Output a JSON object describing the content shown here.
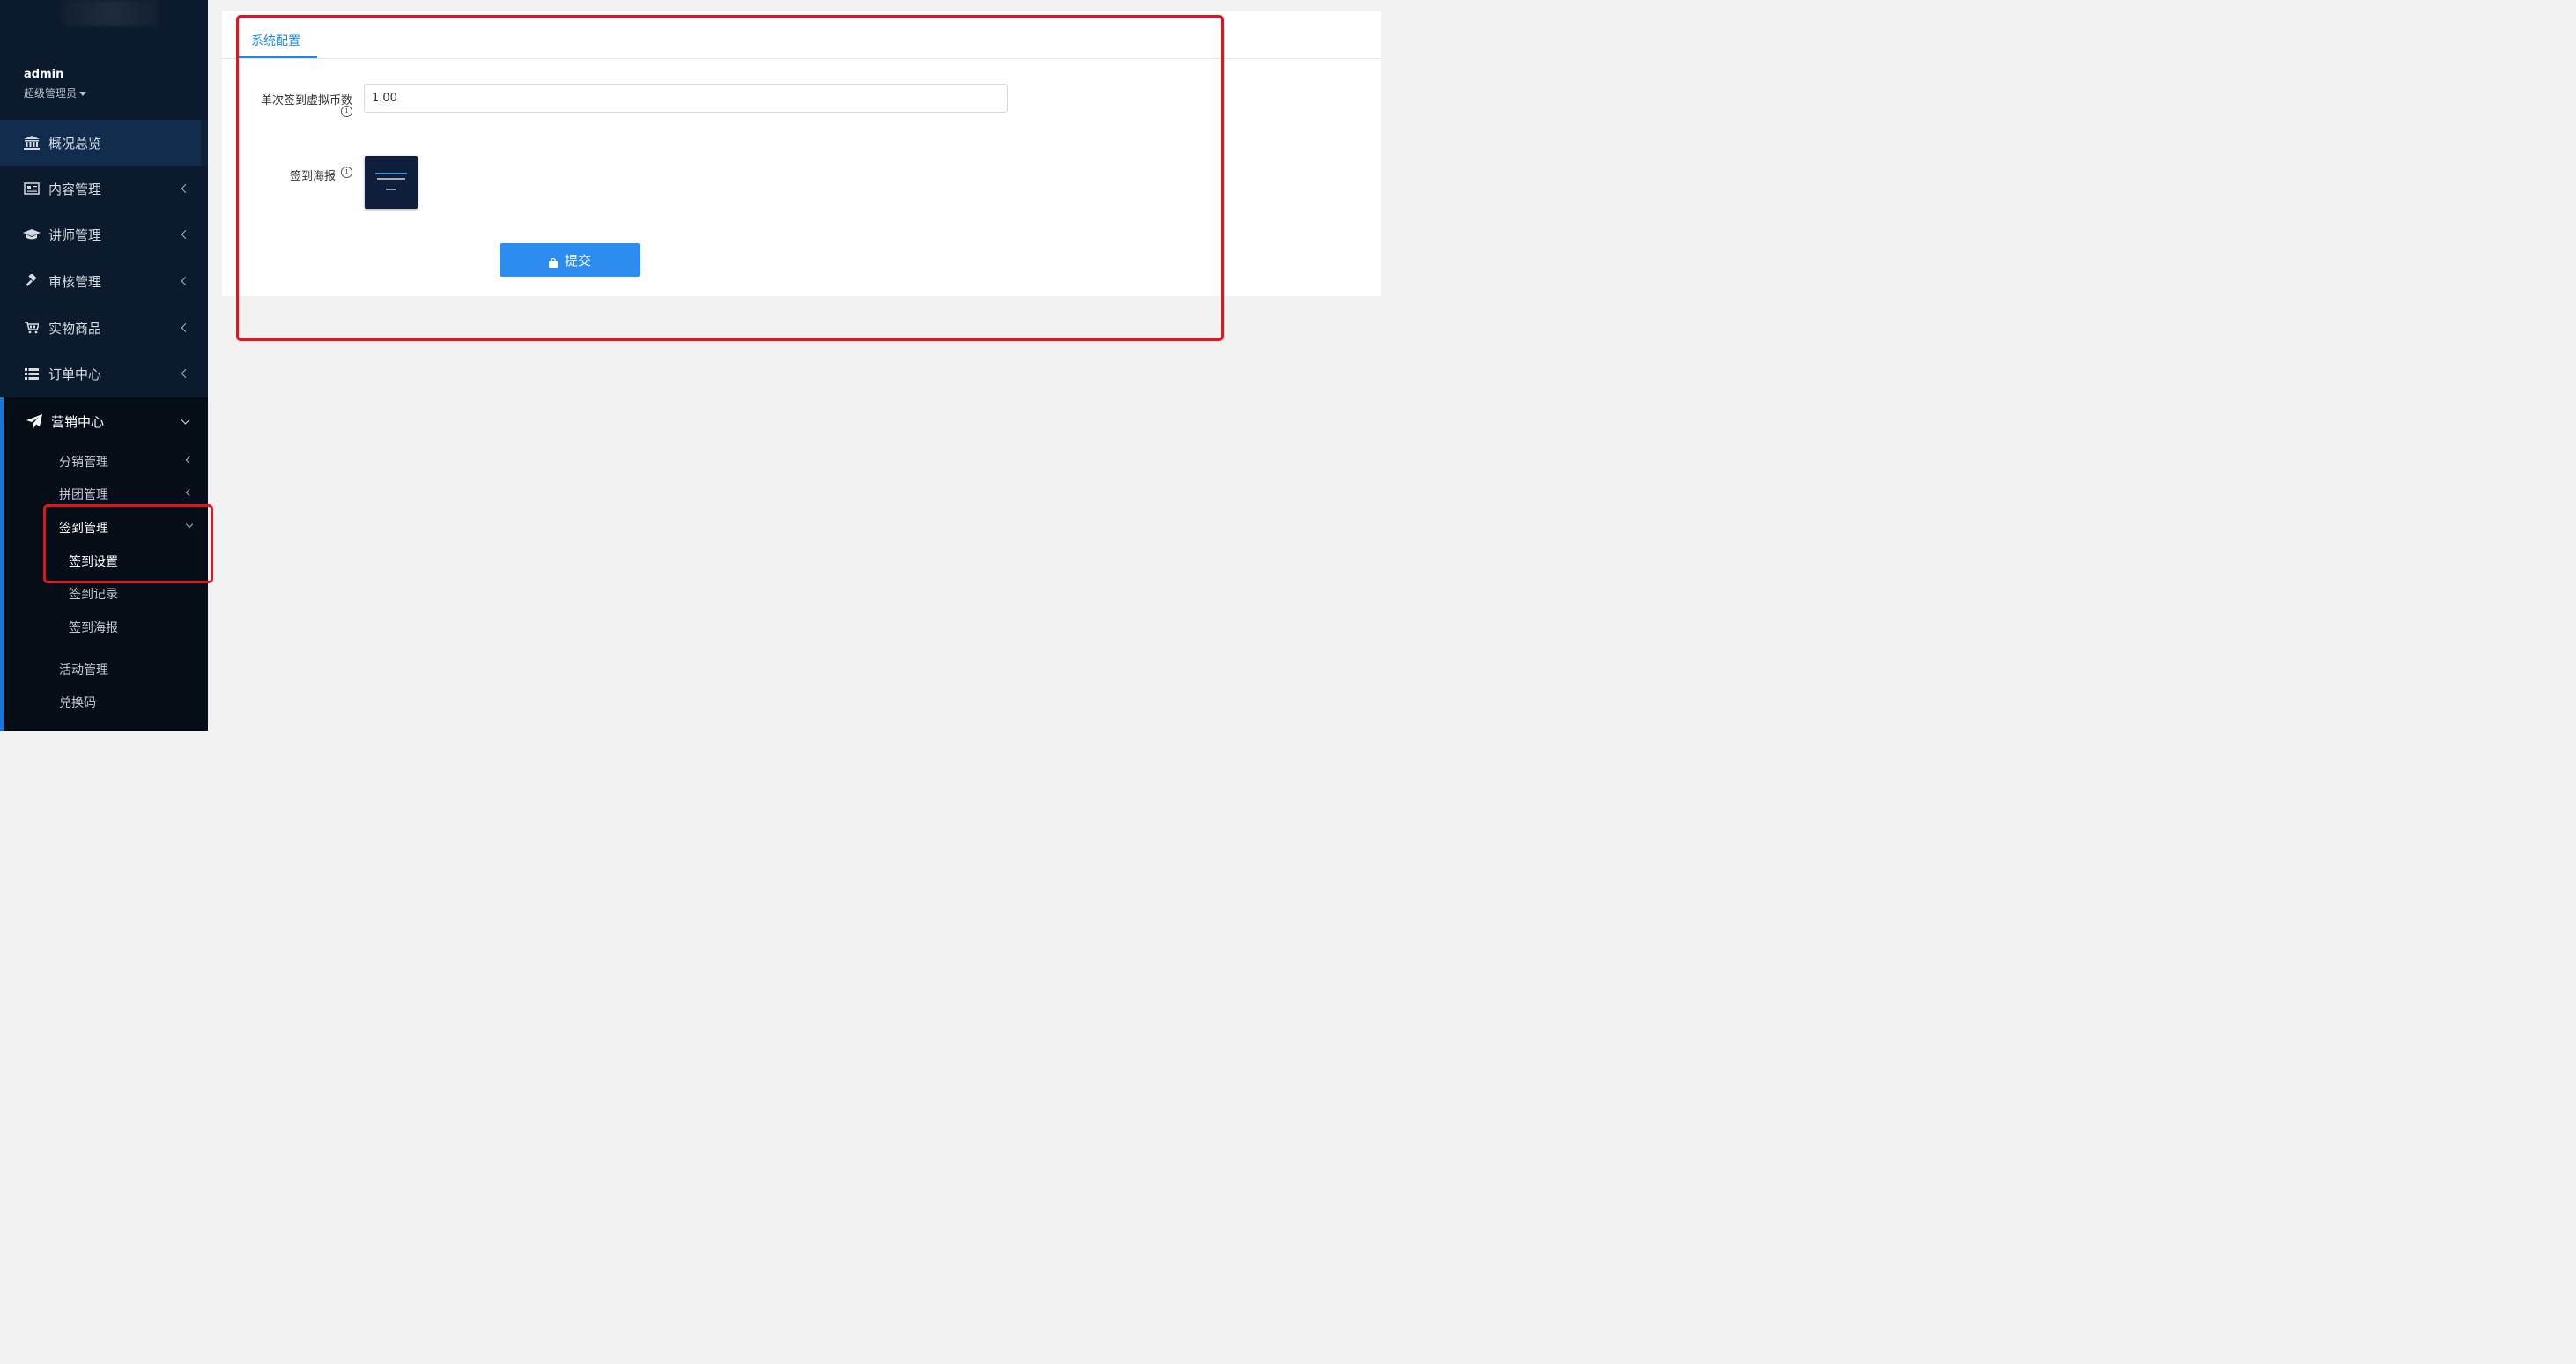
{
  "sidebar": {
    "user": {
      "name": "admin",
      "role": "超级管理员"
    },
    "menu": [
      {
        "label": "概况总览",
        "icon": "bank-icon"
      },
      {
        "label": "内容管理",
        "icon": "newspaper-icon"
      },
      {
        "label": "讲师管理",
        "icon": "graduation-cap-icon"
      },
      {
        "label": "审核管理",
        "icon": "gavel-icon"
      },
      {
        "label": "实物商品",
        "icon": "cart-icon"
      },
      {
        "label": "订单中心",
        "icon": "list-icon"
      }
    ],
    "marketing": {
      "label": "营销中心",
      "icon": "paper-plane-icon",
      "children": [
        {
          "label": "分销管理"
        },
        {
          "label": "拼团管理"
        },
        {
          "label": "签到管理",
          "children": [
            {
              "label": "签到设置"
            },
            {
              "label": "签到记录"
            },
            {
              "label": "签到海报"
            }
          ]
        },
        {
          "label": "活动管理"
        },
        {
          "label": "兑换码"
        }
      ]
    }
  },
  "main": {
    "tab": "系统配置",
    "form": {
      "coin_label": "单次签到虚拟币数",
      "coin_value": "1.00",
      "poster_label": "签到海报",
      "submit_label": "提交"
    }
  },
  "colors": {
    "sidebar_bg": "#0b1a2c",
    "accent": "#2d8cf0",
    "highlight": "#e3131f"
  }
}
